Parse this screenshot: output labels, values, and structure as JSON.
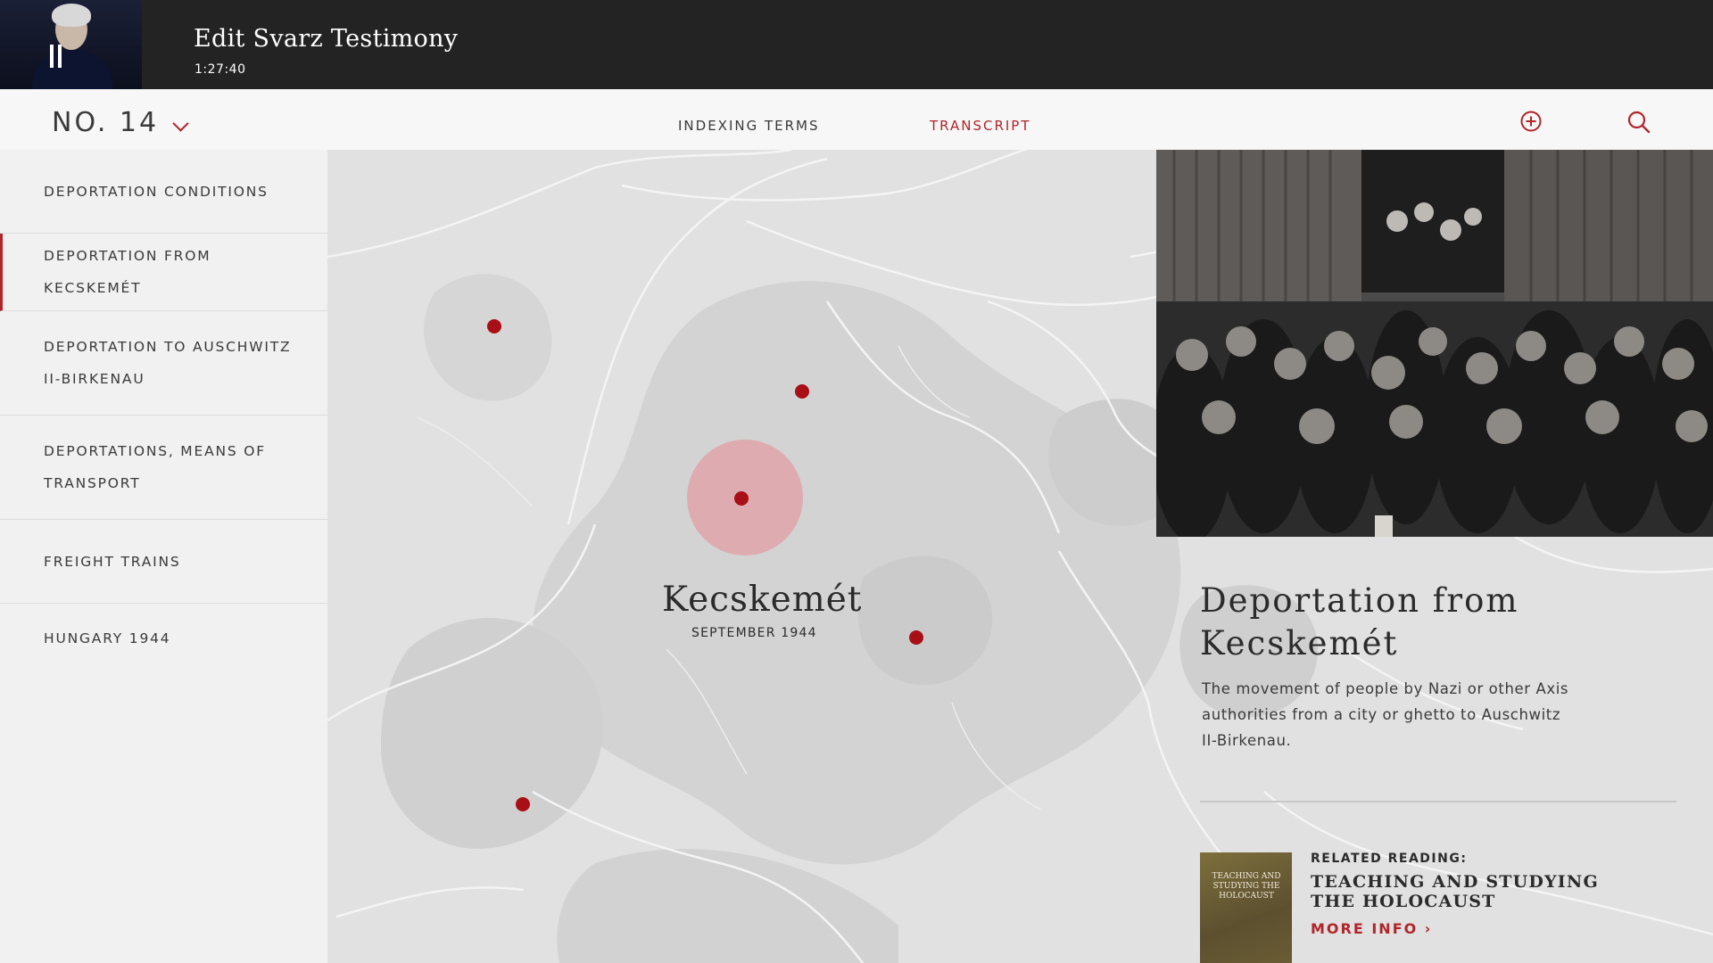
{
  "header": {
    "title": "Edit Svarz Testimony",
    "duration": "1:27:40"
  },
  "nav": {
    "episode": "NO. 14",
    "tabs": [
      "INDEXING TERMS",
      "TRANSCRIPT"
    ],
    "active_tab": "TRANSCRIPT"
  },
  "sidebar": {
    "items": [
      {
        "label": "DEPORTATION CONDITIONS"
      },
      {
        "label": "DEPORTATION FROM KECSKEMÉT"
      },
      {
        "label": "DEPORTATION TO AUSCHWITZ II-BIRKENAU"
      },
      {
        "label": "DEPORTATIONS, MEANS OF TRANSPORT"
      },
      {
        "label": "FREIGHT TRAINS"
      },
      {
        "label": "HUNGARY 1944"
      }
    ],
    "active_index": 1
  },
  "map": {
    "city": "Kecskemét",
    "date": "SEPTEMBER 1944"
  },
  "detail": {
    "title": "Deportation from Kecskemét",
    "description": "The movement of people by Nazi or other Axis authorities from a city or ghetto to Auschwitz II-Birkenau."
  },
  "related": {
    "label": "RELATED READING:",
    "title": "TEACHING AND STUDYING THE HOLOCAUST",
    "more": "MORE INFO ›",
    "book_cover_text": "TEACHING AND STUDYING THE HOLOCAUST"
  },
  "colors": {
    "accent": "#b0252a",
    "topbar": "#232323",
    "marker": "#a80f17"
  },
  "icons": [
    "pause-icon",
    "chevron-down-icon",
    "add-circle-icon",
    "search-icon"
  ]
}
